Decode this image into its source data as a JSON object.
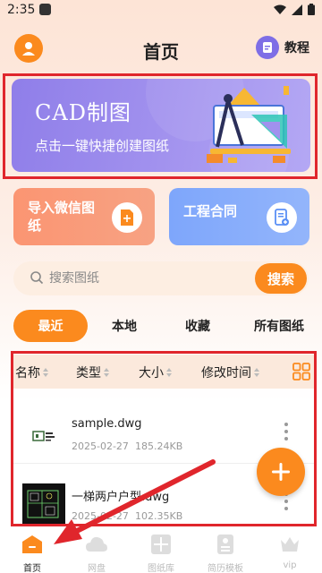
{
  "status_bar": {
    "time": "2:35"
  },
  "header": {
    "title": "首页",
    "tutorial_label": "教程"
  },
  "banner": {
    "title": "CAD制图",
    "subtitle": "点击一键快捷创建图纸"
  },
  "cards": [
    {
      "label": "导入微信图纸",
      "icon": "file-import-icon"
    },
    {
      "label": "工程合同",
      "icon": "contract-icon"
    }
  ],
  "search": {
    "placeholder": "搜索图纸",
    "button_label": "搜索"
  },
  "tabs": [
    {
      "label": "最近",
      "active": true
    },
    {
      "label": "本地",
      "active": false
    },
    {
      "label": "收藏",
      "active": false
    },
    {
      "label": "所有图纸",
      "active": false
    }
  ],
  "list_header": {
    "columns": [
      "名称",
      "类型",
      "大小",
      "修改时间"
    ]
  },
  "files": [
    {
      "name": "sample.dwg",
      "date": "2025-02-27",
      "size": "185.24KB"
    },
    {
      "name": "一梯两户户型.dwg",
      "date": "2025-02-27",
      "size": "102.35KB"
    }
  ],
  "bottom_nav": [
    {
      "label": "首页",
      "active": true
    },
    {
      "label": "网盘",
      "active": false
    },
    {
      "label": "图纸库",
      "active": false
    },
    {
      "label": "简历模板",
      "active": false
    },
    {
      "label": "vip",
      "active": false
    }
  ],
  "colors": {
    "accent": "#fb8a1e",
    "banner": "#9b8aec",
    "annotation": "#e0262c"
  }
}
